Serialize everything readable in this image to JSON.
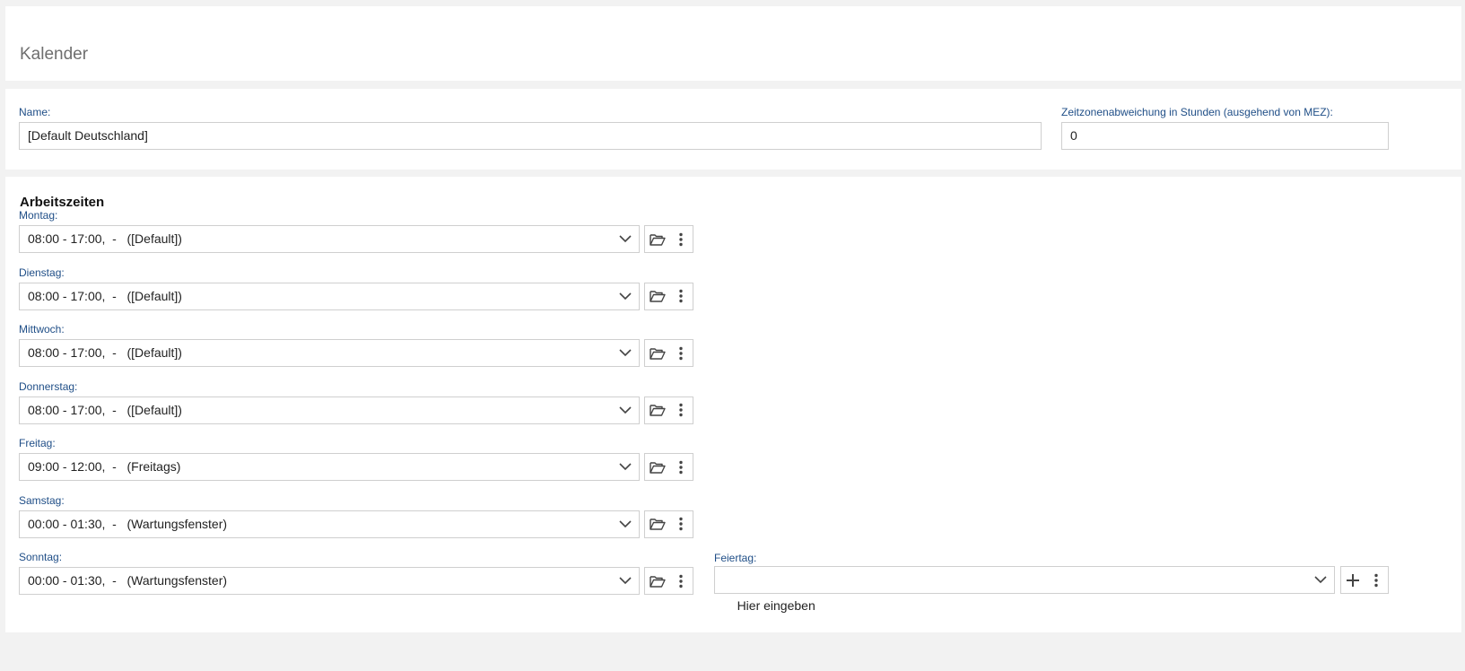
{
  "page": {
    "title": "Kalender"
  },
  "name_field": {
    "label": "Name:",
    "value": "[Default Deutschland]"
  },
  "timezone_field": {
    "label": "Zeitzonenabweichung in Stunden (ausgehend von MEZ):",
    "value": "0"
  },
  "work_hours": {
    "title": "Arbeitszeiten",
    "days": [
      {
        "label": "Montag:",
        "value": "08:00 - 17:00,  -   ([Default])"
      },
      {
        "label": "Dienstag:",
        "value": "08:00 - 17:00,  -   ([Default])"
      },
      {
        "label": "Mittwoch:",
        "value": "08:00 - 17:00,  -   ([Default])"
      },
      {
        "label": "Donnerstag:",
        "value": "08:00 - 17:00,  -   ([Default])"
      },
      {
        "label": "Freitag:",
        "value": "09:00 - 12:00,  -   (Freitags)"
      },
      {
        "label": "Samstag:",
        "value": "00:00 - 01:30,  -   (Wartungsfenster)"
      },
      {
        "label": "Sonntag:",
        "value": "00:00 - 01:30,  -   (Wartungsfenster)"
      }
    ]
  },
  "holiday_field": {
    "label": "Feiertag:",
    "placeholder": "Hier eingeben"
  },
  "icons": {
    "browse": "folder-open-icon",
    "more": "more-vertical-icon",
    "add": "plus-icon",
    "dropdown": "chevron-down-icon"
  },
  "colors": {
    "label": "#1f4e87",
    "border": "#cfcfcf",
    "background": "#f2f2f2"
  }
}
